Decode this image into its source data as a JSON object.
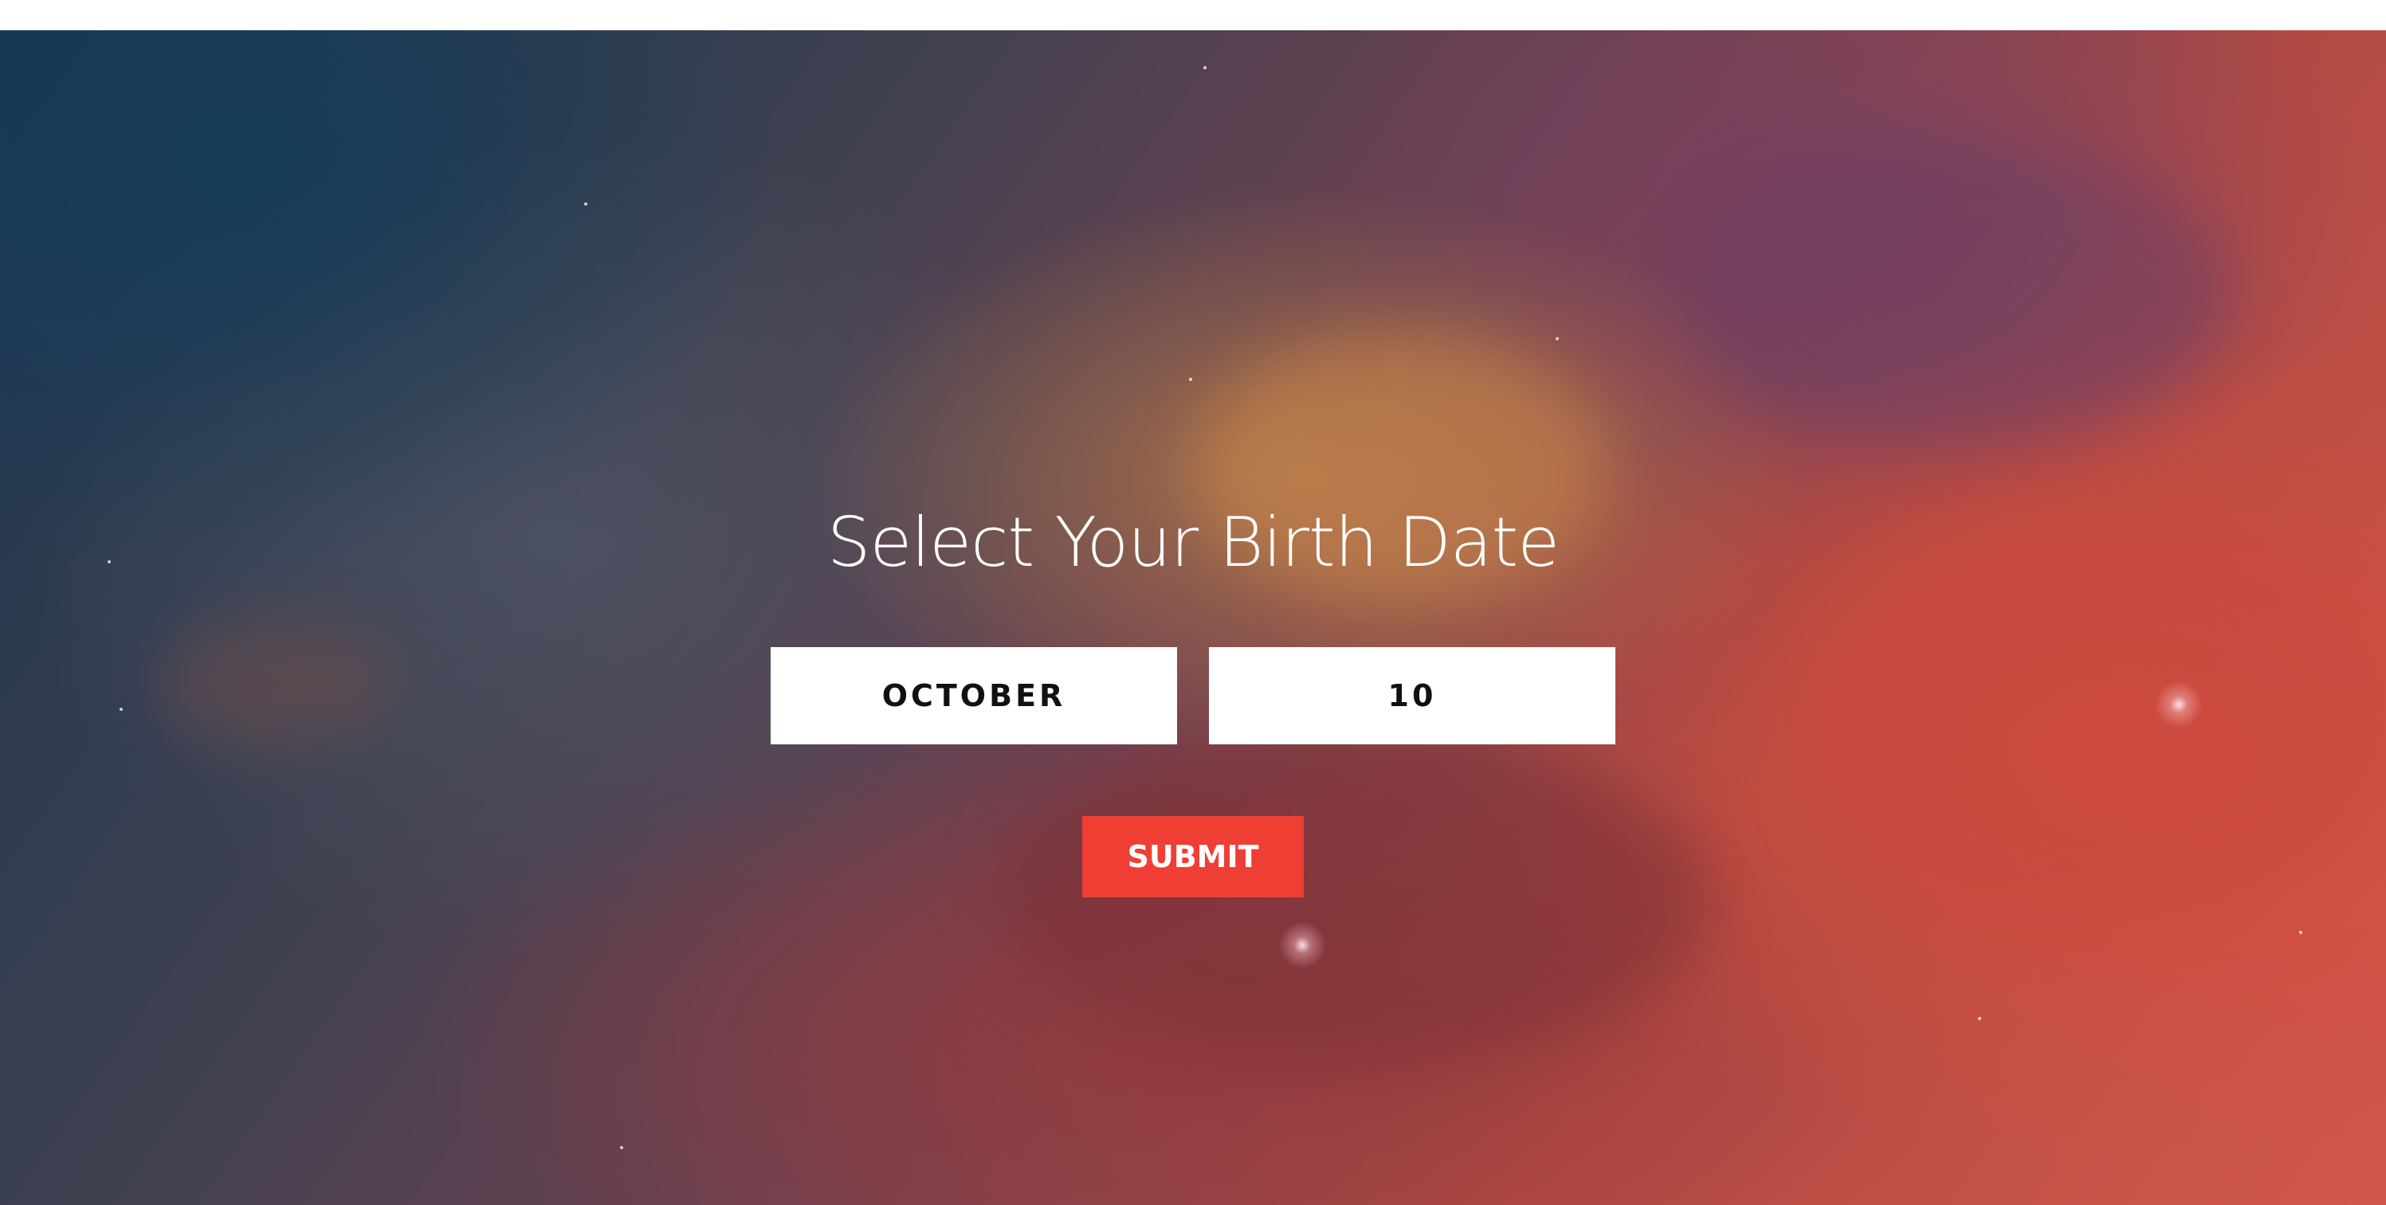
{
  "page": {
    "title": "Select Your Birth Date"
  },
  "birth_date": {
    "month": "OCTOBER",
    "day": "10"
  },
  "actions": {
    "submit_label": "SUBMIT"
  },
  "colors": {
    "accent": "#ef3f35",
    "field_background": "#ffffff",
    "title_text": "#ffffff"
  }
}
